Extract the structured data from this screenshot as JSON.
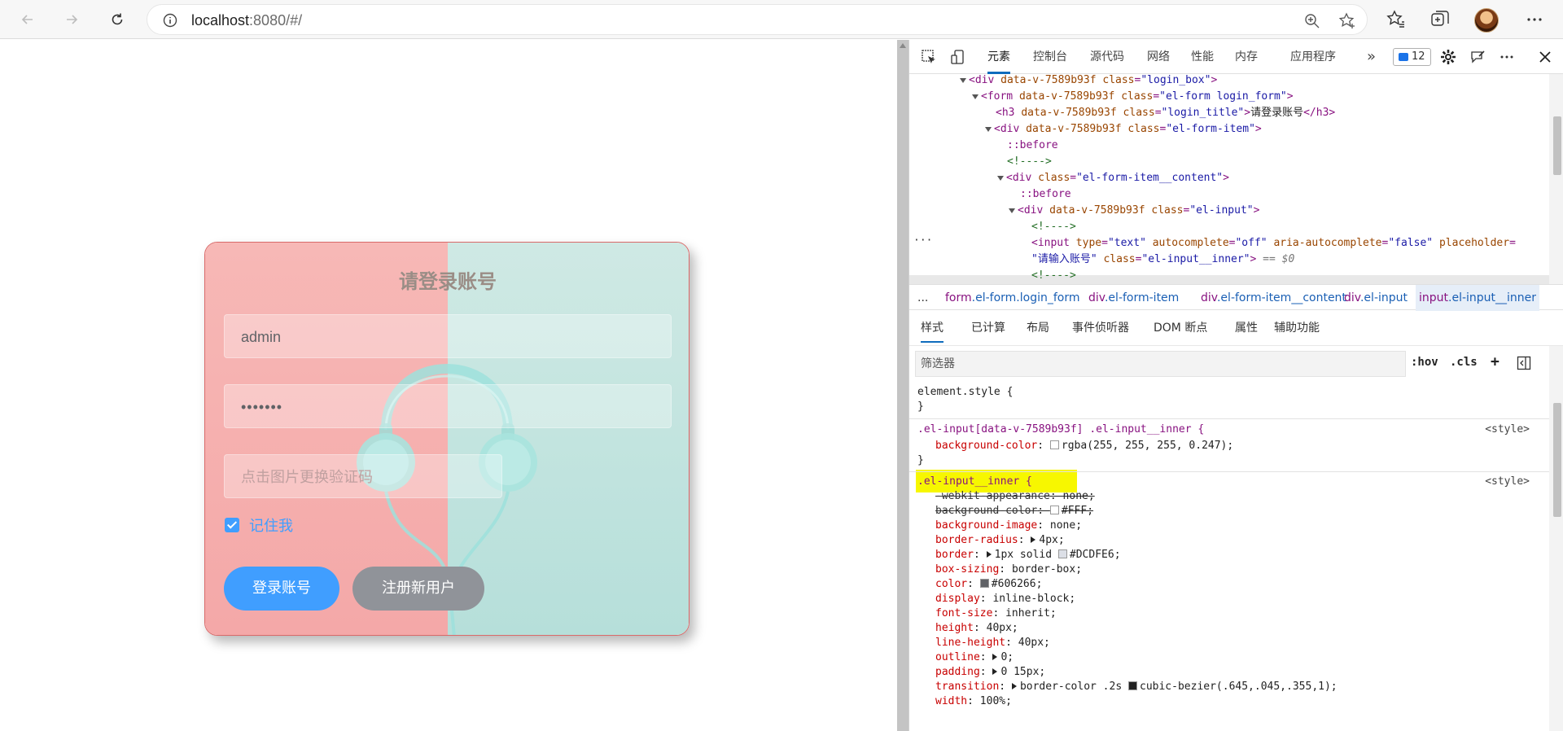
{
  "browser": {
    "url_host": "localhost",
    "url_rest": ":8080/#/",
    "icons": [
      "back-icon",
      "forward-icon",
      "refresh-icon",
      "info-icon",
      "zoom-icon",
      "add-favorite-icon",
      "favorites-icon",
      "collections-icon",
      "profile-avatar",
      "more-icon"
    ]
  },
  "login": {
    "title": "请登录账号",
    "username_value": "admin",
    "password_value": "•••••••",
    "captcha_placeholder": "点击图片更换验证码",
    "remember_label": "记住我",
    "login_button": "登录账号",
    "register_button": "注册新用户",
    "colors": {
      "left_bg": "#f4a8a8",
      "right_bg": "#b6dfda",
      "primary": "#409EFF",
      "gray": "#909399"
    }
  },
  "devtools": {
    "tabs": [
      "元素",
      "控制台",
      "源代码",
      "网络",
      "性能",
      "内存",
      "应用程序"
    ],
    "more_tabs": "»",
    "issues_count": "12",
    "dom": {
      "l1": {
        "tag": "div",
        "attr1": "data-v-7589b93f",
        "attr2": "class",
        "val2": "\"login_box\""
      },
      "l2": {
        "tag": "form",
        "attr1": "data-v-7589b93f",
        "attr2": "class",
        "val2": "\"el-form login_form\""
      },
      "l3": {
        "tag": "h3",
        "attr1": "data-v-7589b93f",
        "attr2": "class",
        "val2": "\"login_title\"",
        "text": "请登录账号",
        "close": "</h3>"
      },
      "l4": {
        "tag": "div",
        "attr1": "data-v-7589b93f",
        "attr2": "class",
        "val2": "\"el-form-item\""
      },
      "l5": "::before",
      "l6": "<!---->",
      "l7": {
        "tag": "div",
        "attr2": "class",
        "val2": "\"el-form-item__content\""
      },
      "l8": "::before",
      "l9": {
        "tag": "div",
        "attr1": "data-v-7589b93f",
        "attr2": "class",
        "val2": "\"el-input\""
      },
      "l10": "<!---->",
      "sel1": {
        "tag": "input",
        "a1": "type",
        "v1": "\"text\"",
        "a2": "autocomplete",
        "v2": "\"off\"",
        "a3": "aria-autocomplete",
        "v3": "\"false\"",
        "a4": "placeholder"
      },
      "sel2": {
        "v4": "\"请输入账号\"",
        "a5": "class",
        "v5": "\"el-input__inner\"",
        "eq": "== $0"
      },
      "l12": "<!---->",
      "dots": "···"
    },
    "breadcrumbs": [
      {
        "tag": "form",
        "sub": ".el-form.login_form"
      },
      {
        "tag": "div",
        "sub": ".el-form-item"
      },
      {
        "tag": "div",
        "sub": ".el-form-item__content"
      },
      {
        "tag": "div",
        "sub": ".el-input"
      },
      {
        "tag": "input",
        "sub": ".el-input__inner"
      }
    ],
    "crumb_more": "...",
    "style_tabs": [
      "样式",
      "已计算",
      "布局",
      "事件侦听器",
      "DOM 断点",
      "属性",
      "辅助功能"
    ],
    "filter_placeholder": "筛选器",
    "filter_buttons": [
      ":hov",
      ".cls",
      "+"
    ],
    "styles": {
      "r1_selector": "element.style {",
      "close": "}",
      "r2_selector": ".el-input[data-v-7589b93f] .el-input__inner {",
      "r2_prop": "background-color",
      "r2_val": "rgba(255, 255, 255, 0.247);",
      "source": "<style>",
      "r3_selector": ".el-input__inner {",
      "props": [
        {
          "n": "-webkit-appearance",
          "v": "none;",
          "strike": true
        },
        {
          "n": "background-color",
          "v": "#FFF;",
          "strike": true,
          "swatch": "#FFFFFF"
        },
        {
          "n": "background-image",
          "v": "none;"
        },
        {
          "n": "border-radius",
          "v": "4px;",
          "expand": true
        },
        {
          "n": "border",
          "v": "1px solid",
          "v2": "#DCDFE6;",
          "expand": true,
          "swatch": "#DCDFE6"
        },
        {
          "n": "box-sizing",
          "v": "border-box;"
        },
        {
          "n": "color",
          "v": "#606266;",
          "swatch": "#606266"
        },
        {
          "n": "display",
          "v": "inline-block;"
        },
        {
          "n": "font-size",
          "v": "inherit;"
        },
        {
          "n": "height",
          "v": "40px;"
        },
        {
          "n": "line-height",
          "v": "40px;"
        },
        {
          "n": "outline",
          "v": "0;",
          "expand": true
        },
        {
          "n": "padding",
          "v": "0 15px;",
          "expand": true
        },
        {
          "n": "transition",
          "v": "border-color .2s",
          "v2": "cubic-bezier(.645,.045,.355,1);",
          "expand": true,
          "curve": true
        },
        {
          "n": "width",
          "v": "100%;"
        }
      ]
    }
  }
}
